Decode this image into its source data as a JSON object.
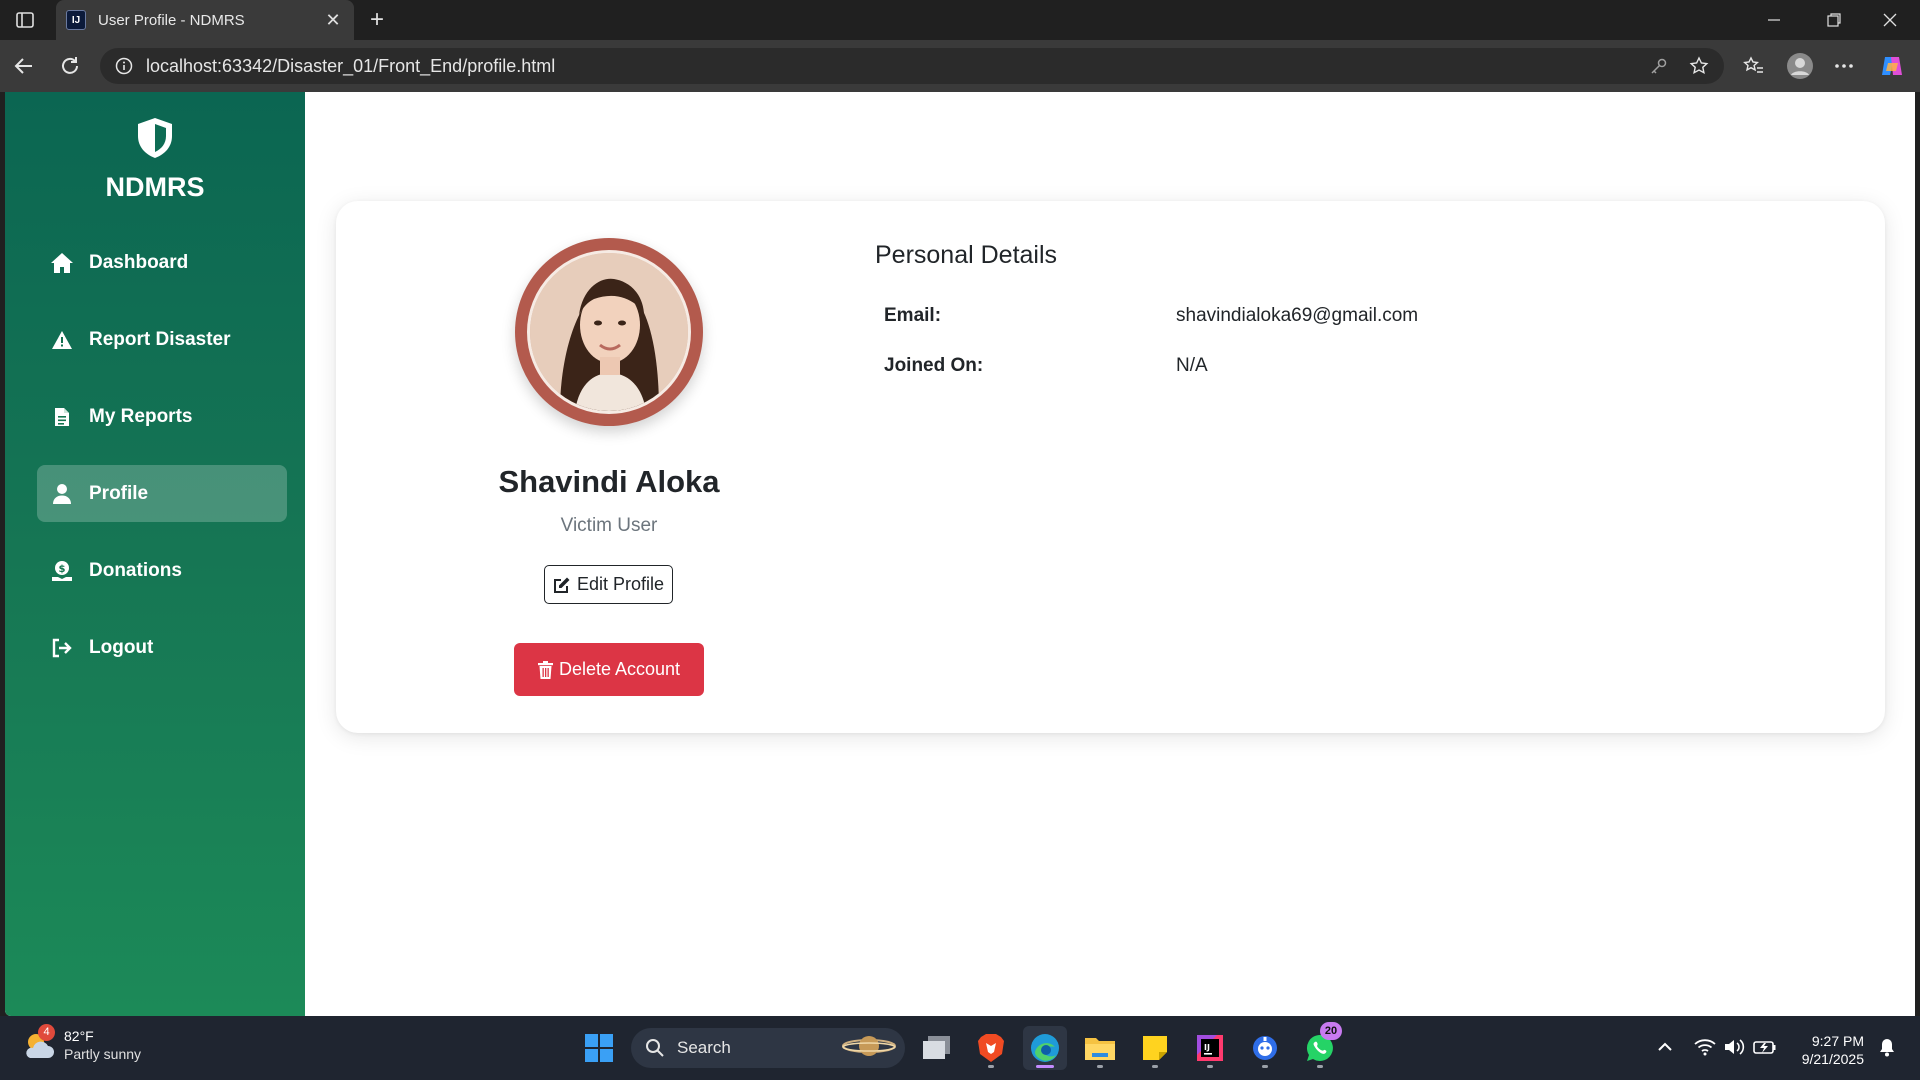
{
  "browser": {
    "tab_title": "User Profile - NDMRS",
    "tab_favicon": "IJ",
    "url": "localhost:63342/Disaster_01/Front_End/profile.html"
  },
  "sidebar": {
    "brand": "NDMRS",
    "brand_icon": "shield-icon",
    "items": [
      {
        "label": "Dashboard",
        "icon": "home-icon"
      },
      {
        "label": "Report Disaster",
        "icon": "warning-icon"
      },
      {
        "label": "My Reports",
        "icon": "document-icon"
      },
      {
        "label": "Profile",
        "icon": "user-icon",
        "active": true
      },
      {
        "label": "Donations",
        "icon": "donation-icon"
      },
      {
        "label": "Logout",
        "icon": "logout-icon"
      }
    ]
  },
  "profile": {
    "name": "Shavindi Aloka",
    "role": "Victim User",
    "edit_label": "Edit Profile",
    "delete_label": "Delete Account"
  },
  "details": {
    "title": "Personal Details",
    "rows": [
      {
        "label": "Email:",
        "value": "shavindialoka69@gmail.com"
      },
      {
        "label": "Joined On:",
        "value": "N/A"
      }
    ]
  },
  "taskbar": {
    "weather_badge": "4",
    "temperature": "82°F",
    "condition": "Partly sunny",
    "search_label": "Search",
    "whatsapp_badge": "20",
    "time": "9:27 PM",
    "date": "9/21/2025"
  },
  "colors": {
    "sidebar_top": "#0b6652",
    "sidebar_bottom": "#1c8a58",
    "delete": "#dc3545",
    "avatar_ring": "#b35a4d"
  }
}
